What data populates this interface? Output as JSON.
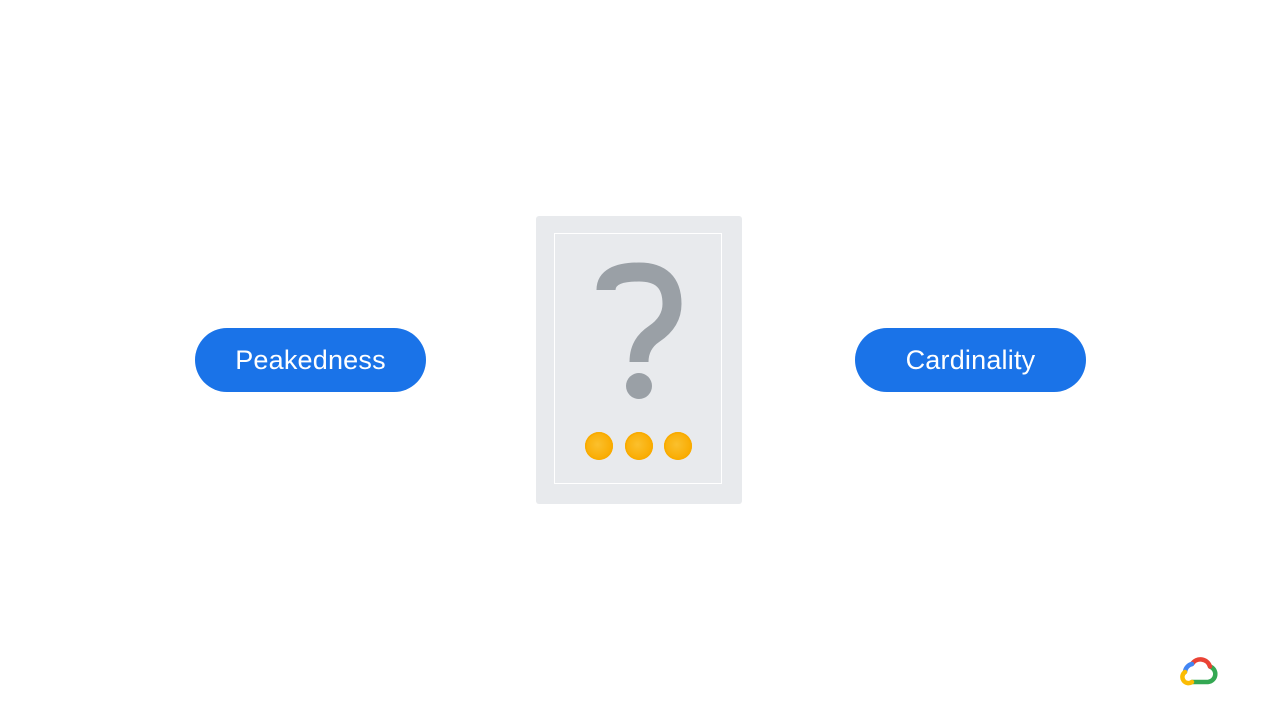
{
  "labels": {
    "left": "Peakedness",
    "right": "Cardinality"
  },
  "card": {
    "symbol": "?",
    "dots_count": 3
  },
  "logo": {
    "icon": "google-cloud-icon"
  },
  "colors": {
    "pill": "#1a73e8",
    "card": "#e8eaed",
    "question": "#9aa0a6",
    "dot": "#f9ab00"
  }
}
